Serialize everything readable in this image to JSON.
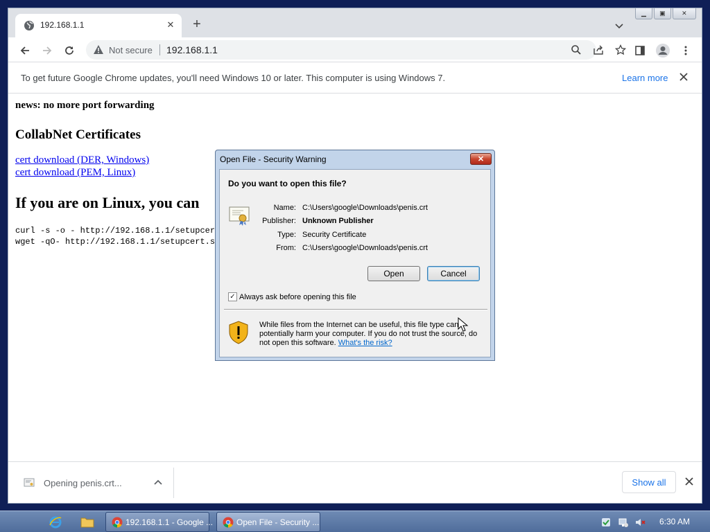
{
  "browser": {
    "tab_title": "192.168.1.1",
    "omnibox": {
      "security_text": "Not secure",
      "url": "192.168.1.1"
    },
    "infobar": {
      "message": "To get future Google Chrome updates, you'll need Windows 10 or later. This computer is using Windows 7.",
      "link": "Learn more"
    },
    "downloads": {
      "item": "Opening penis.crt...",
      "show_all": "Show all"
    }
  },
  "page": {
    "news": "news: no more port forwarding",
    "heading": "CollabNet Certificates",
    "links": [
      "cert download (DER, Windows)",
      "cert download (PEM, Linux)"
    ],
    "linux_heading": "If you are on Linux, you can",
    "code_lines": [
      "curl -s -o - http://192.168.1.1/setupcert",
      "wget -qO- http://192.168.1.1/setupcert.sh"
    ]
  },
  "dialog": {
    "title": "Open File - Security Warning",
    "question": "Do you want to open this file?",
    "fields": [
      {
        "label": "Name:",
        "value": "C:\\Users\\google\\Downloads\\penis.crt",
        "bold": false
      },
      {
        "label": "Publisher:",
        "value": "Unknown Publisher",
        "bold": true
      },
      {
        "label": "Type:",
        "value": "Security Certificate",
        "bold": false
      },
      {
        "label": "From:",
        "value": "C:\\Users\\google\\Downloads\\penis.crt",
        "bold": false
      }
    ],
    "open_label": "Open",
    "cancel_label": "Cancel",
    "checkbox_label": "Always ask before opening this file",
    "checkbox_checked": true,
    "warning_text": "While files from the Internet can be useful, this file type can potentially harm your computer. If you do not trust the source, do not open this software.",
    "risk_link": "What's the risk?"
  },
  "taskbar": {
    "buttons": [
      "192.168.1.1 - Google ...",
      "Open File - Security ..."
    ],
    "clock": "6:30 AM"
  },
  "colors": {
    "accent": "#1a73e8",
    "desktop": "#0f1f57",
    "link": "#0000ee"
  }
}
